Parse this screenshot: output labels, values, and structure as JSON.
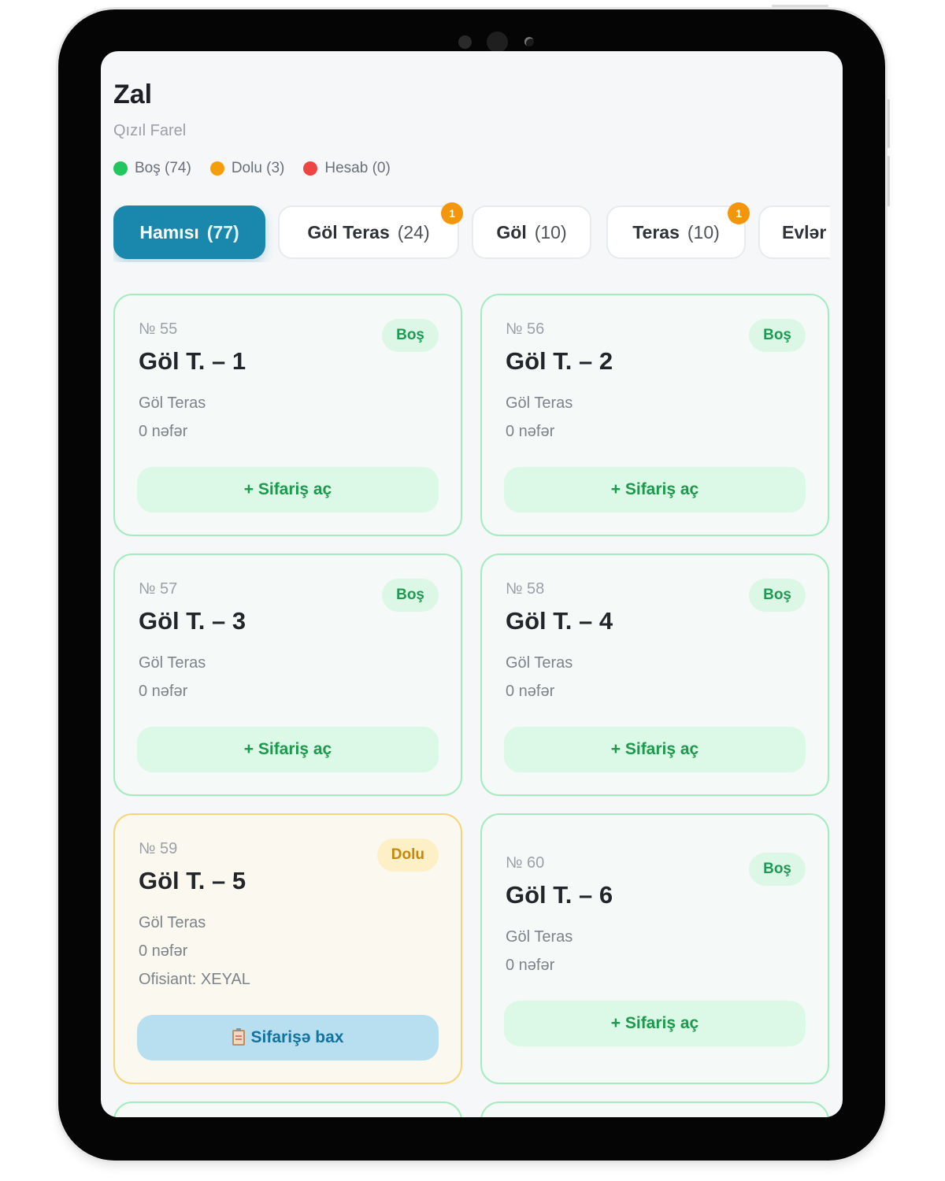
{
  "page": {
    "title": "Zal",
    "subtitle": "Qızıl Farel"
  },
  "legend": [
    {
      "label": "Boş (74)",
      "color": "#22c55e"
    },
    {
      "label": "Dolu (3)",
      "color": "#f59e0b"
    },
    {
      "label": "Hesab (0)",
      "color": "#ef4444"
    }
  ],
  "tabs": [
    {
      "label": "Hamısı",
      "count": "(77)",
      "active": true
    },
    {
      "label": "Göl Teras",
      "count": "(24)",
      "badge": "1"
    },
    {
      "label": "Göl",
      "count": "(10)"
    },
    {
      "label": "Teras",
      "count": "(10)",
      "badge": "1"
    },
    {
      "label": "Evlər",
      "count": ""
    }
  ],
  "tables": [
    {
      "number": "№ 55",
      "name": "Göl T. – 1",
      "zone": "Göl Teras",
      "seats": "0 nəfər",
      "status": "Boş",
      "action": "+ Sifariş aç"
    },
    {
      "number": "№ 56",
      "name": "Göl T. – 2",
      "zone": "Göl Teras",
      "seats": "0 nəfər",
      "status": "Boş",
      "action": "+ Sifariş aç"
    },
    {
      "number": "№ 57",
      "name": "Göl T. – 3",
      "zone": "Göl Teras",
      "seats": "0 nəfər",
      "status": "Boş",
      "action": "+ Sifariş aç"
    },
    {
      "number": "№ 58",
      "name": "Göl T. – 4",
      "zone": "Göl Teras",
      "seats": "0 nəfər",
      "status": "Boş",
      "action": "+ Sifariş aç"
    },
    {
      "number": "№ 59",
      "name": "Göl T. – 5",
      "zone": "Göl Teras",
      "seats": "0 nəfər",
      "waiter": "Ofisiant: XEYAL",
      "status": "Dolu",
      "action": "Sifarişə bax",
      "action_icon": "clipboard-icon"
    },
    {
      "number": "№ 60",
      "name": "Göl T. – 6",
      "zone": "Göl Teras",
      "seats": "0 nəfər",
      "status": "Boş",
      "action": "+ Sifariş aç"
    }
  ]
}
